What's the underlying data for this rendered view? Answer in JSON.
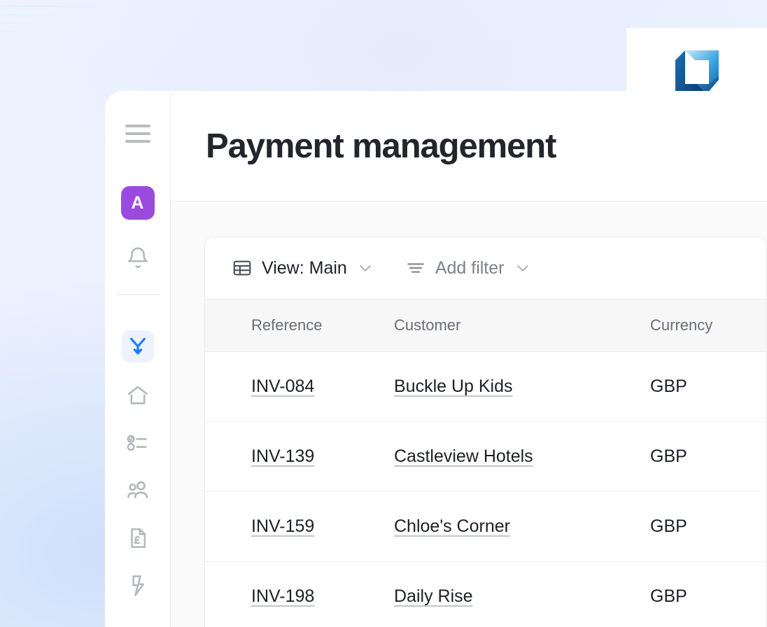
{
  "brand": {
    "logo_icon": "logo-mark",
    "logo_colors": [
      "#1a5fa8",
      "#2d9cdb",
      "#7fc8f0",
      "#0f4e8a"
    ]
  },
  "sidebar": {
    "menu_icon": "hamburger-menu-icon",
    "avatar": {
      "initial": "A",
      "color": "#9b4ae0"
    },
    "items": [
      {
        "name": "notifications",
        "icon": "bell-icon",
        "active": false
      },
      {
        "name": "flows",
        "icon": "merge-arrow-down-icon",
        "active": true
      },
      {
        "name": "home",
        "icon": "home-icon",
        "active": false
      },
      {
        "name": "tasks",
        "icon": "checklist-icon",
        "active": false
      },
      {
        "name": "contacts",
        "icon": "people-icon",
        "active": false
      },
      {
        "name": "invoices",
        "icon": "document-pound-icon",
        "active": false
      },
      {
        "name": "automations",
        "icon": "lightning-bolt-icon",
        "active": false
      }
    ]
  },
  "header": {
    "title": "Payment management"
  },
  "toolbar": {
    "view": {
      "icon": "table-grid-icon",
      "label": "View: Main",
      "caret": "chevron-down-icon"
    },
    "filter": {
      "icon": "filter-lines-icon",
      "label": "Add filter",
      "caret": "chevron-down-icon"
    }
  },
  "table": {
    "columns": [
      "Reference",
      "Customer",
      "Currency"
    ],
    "rows": [
      {
        "reference": "INV-084",
        "customer": "Buckle Up Kids",
        "currency": "GBP"
      },
      {
        "reference": "INV-139",
        "customer": "Castleview Hotels",
        "currency": "GBP"
      },
      {
        "reference": "INV-159",
        "customer": "Chloe's Corner",
        "currency": "GBP"
      },
      {
        "reference": "INV-198",
        "customer": "Daily Rise",
        "currency": "GBP"
      }
    ]
  }
}
